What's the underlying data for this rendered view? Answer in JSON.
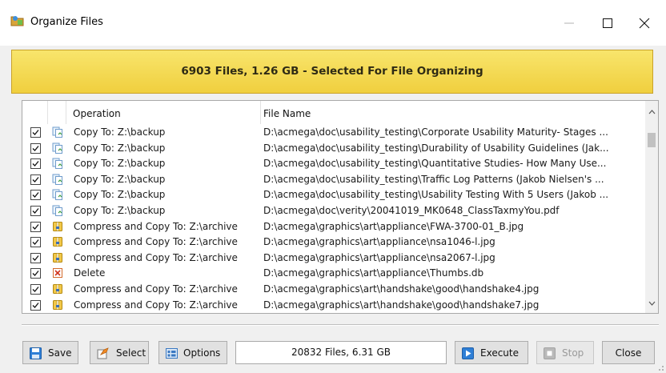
{
  "window": {
    "title": "Organize Files"
  },
  "banner": {
    "text": "6903 Files, 1.26 GB - Selected For File Organizing"
  },
  "grid": {
    "columns": {
      "operation": "Operation",
      "file_name": "File Name"
    },
    "rows": [
      {
        "checked": true,
        "icon": "copy-icon",
        "operation": "Copy To: Z:\\backup",
        "file": "D:\\acmega\\doc\\usability_testing\\Corporate Usability Maturity- Stages ..."
      },
      {
        "checked": true,
        "icon": "copy-icon",
        "operation": "Copy To: Z:\\backup",
        "file": "D:\\acmega\\doc\\usability_testing\\Durability of Usability Guidelines (Jak..."
      },
      {
        "checked": true,
        "icon": "copy-icon",
        "operation": "Copy To: Z:\\backup",
        "file": "D:\\acmega\\doc\\usability_testing\\Quantitative Studies- How Many Use..."
      },
      {
        "checked": true,
        "icon": "copy-icon",
        "operation": "Copy To: Z:\\backup",
        "file": "D:\\acmega\\doc\\usability_testing\\Traffic Log Patterns (Jakob Nielsen's ..."
      },
      {
        "checked": true,
        "icon": "copy-icon",
        "operation": "Copy To: Z:\\backup",
        "file": "D:\\acmega\\doc\\usability_testing\\Usability Testing With 5 Users (Jakob ..."
      },
      {
        "checked": true,
        "icon": "copy-icon",
        "operation": "Copy To: Z:\\backup",
        "file": "D:\\acmega\\doc\\verity\\20041019_MK0648_ClassTaxmyYou.pdf"
      },
      {
        "checked": true,
        "icon": "compress-icon",
        "operation": "Compress and Copy To: Z:\\archive",
        "file": "D:\\acmega\\graphics\\art\\appliance\\FWA-3700-01_B.jpg"
      },
      {
        "checked": true,
        "icon": "compress-icon",
        "operation": "Compress and Copy To: Z:\\archive",
        "file": "D:\\acmega\\graphics\\art\\appliance\\nsa1046-l.jpg"
      },
      {
        "checked": true,
        "icon": "compress-icon",
        "operation": "Compress and Copy To: Z:\\archive",
        "file": "D:\\acmega\\graphics\\art\\appliance\\nsa2067-l.jpg"
      },
      {
        "checked": true,
        "icon": "delete-icon",
        "operation": "Delete",
        "file": "D:\\acmega\\graphics\\art\\appliance\\Thumbs.db"
      },
      {
        "checked": true,
        "icon": "compress-icon",
        "operation": "Compress and Copy To: Z:\\archive",
        "file": "D:\\acmega\\graphics\\art\\handshake\\good\\handshake4.jpg"
      },
      {
        "checked": true,
        "icon": "compress-icon",
        "operation": "Compress and Copy To: Z:\\archive",
        "file": "D:\\acmega\\graphics\\art\\handshake\\good\\handshake7.jpg"
      }
    ]
  },
  "toolbar": {
    "save_label": "Save",
    "select_label": "Select",
    "options_label": "Options",
    "status": "20832 Files, 6.31 GB",
    "execute_label": "Execute",
    "stop_label": "Stop",
    "close_label": "Close"
  },
  "colors": {
    "banner_top": "#f8e56c",
    "banner_bottom": "#f0cf3e",
    "accent_blue": "#2f7fd6"
  }
}
